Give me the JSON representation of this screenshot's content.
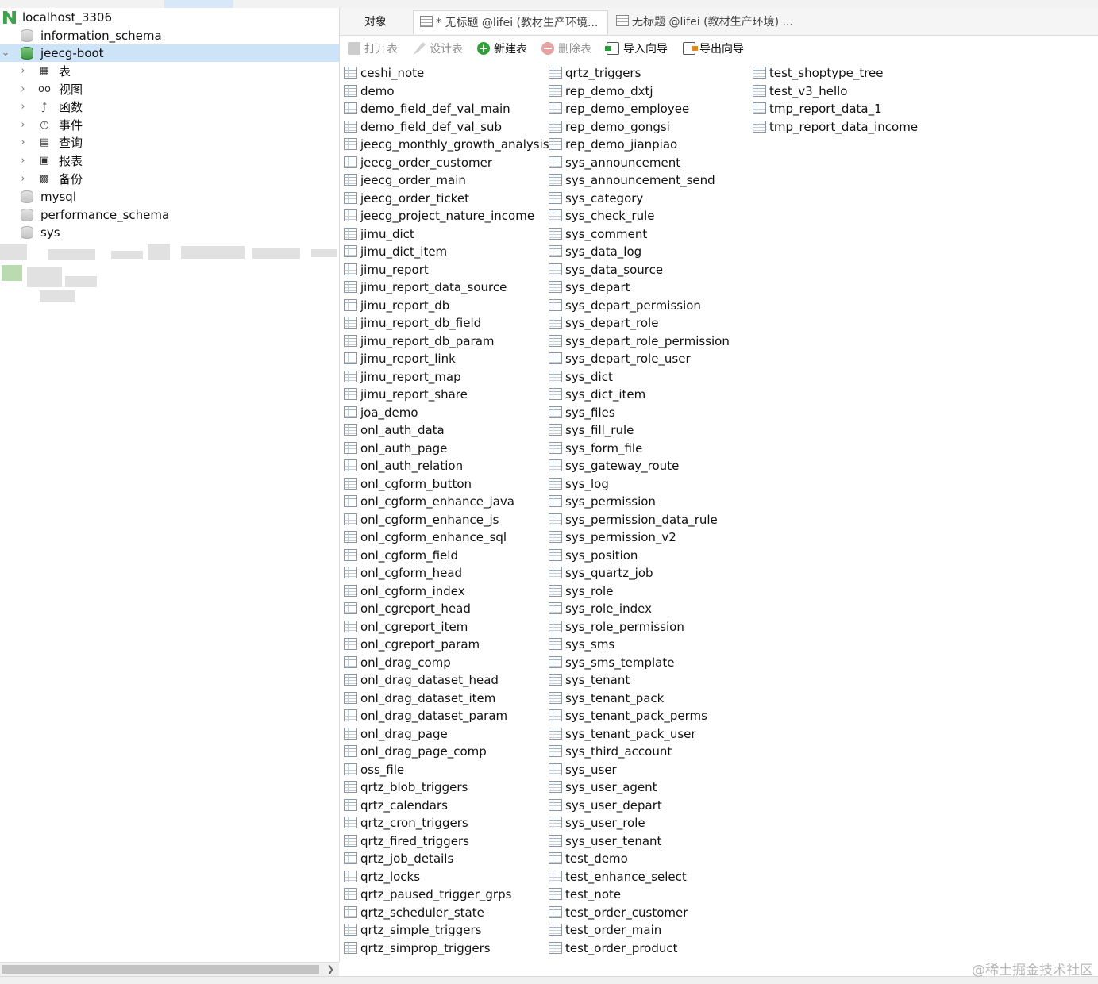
{
  "sidebar": {
    "connection": "localhost_3306",
    "databases": [
      "information_schema",
      "jeecg-boot"
    ],
    "categories": [
      {
        "label": "表",
        "icon": "table-icon"
      },
      {
        "label": "视图",
        "icon": "view-icon"
      },
      {
        "label": "函数",
        "icon": "function-icon"
      },
      {
        "label": "事件",
        "icon": "event-icon"
      },
      {
        "label": "查询",
        "icon": "query-icon"
      },
      {
        "label": "报表",
        "icon": "report-icon"
      },
      {
        "label": "备份",
        "icon": "backup-icon"
      }
    ],
    "other_databases": [
      "mysql",
      "performance_schema",
      "sys"
    ]
  },
  "tabs": {
    "objects": "对象",
    "tab1": "* 无标题 @lifei (教材生产环境...",
    "tab2": "无标题 @lifei (教材生产环境) ..."
  },
  "toolbar": {
    "open": "打开表",
    "design": "设计表",
    "new": "新建表",
    "delete": "删除表",
    "import": "导入向导",
    "export": "导出向导"
  },
  "tables": {
    "col1": [
      "ceshi_note",
      "demo",
      "demo_field_def_val_main",
      "demo_field_def_val_sub",
      "jeecg_monthly_growth_analysis",
      "jeecg_order_customer",
      "jeecg_order_main",
      "jeecg_order_ticket",
      "jeecg_project_nature_income",
      "jimu_dict",
      "jimu_dict_item",
      "jimu_report",
      "jimu_report_data_source",
      "jimu_report_db",
      "jimu_report_db_field",
      "jimu_report_db_param",
      "jimu_report_link",
      "jimu_report_map",
      "jimu_report_share",
      "joa_demo",
      "onl_auth_data",
      "onl_auth_page",
      "onl_auth_relation",
      "onl_cgform_button",
      "onl_cgform_enhance_java",
      "onl_cgform_enhance_js",
      "onl_cgform_enhance_sql",
      "onl_cgform_field",
      "onl_cgform_head",
      "onl_cgform_index",
      "onl_cgreport_head",
      "onl_cgreport_item",
      "onl_cgreport_param",
      "onl_drag_comp",
      "onl_drag_dataset_head",
      "onl_drag_dataset_item",
      "onl_drag_dataset_param",
      "onl_drag_page",
      "onl_drag_page_comp",
      "oss_file",
      "qrtz_blob_triggers",
      "qrtz_calendars",
      "qrtz_cron_triggers",
      "qrtz_fired_triggers",
      "qrtz_job_details",
      "qrtz_locks",
      "qrtz_paused_trigger_grps",
      "qrtz_scheduler_state",
      "qrtz_simple_triggers",
      "qrtz_simprop_triggers"
    ],
    "col2": [
      "qrtz_triggers",
      "rep_demo_dxtj",
      "rep_demo_employee",
      "rep_demo_gongsi",
      "rep_demo_jianpiao",
      "sys_announcement",
      "sys_announcement_send",
      "sys_category",
      "sys_check_rule",
      "sys_comment",
      "sys_data_log",
      "sys_data_source",
      "sys_depart",
      "sys_depart_permission",
      "sys_depart_role",
      "sys_depart_role_permission",
      "sys_depart_role_user",
      "sys_dict",
      "sys_dict_item",
      "sys_files",
      "sys_fill_rule",
      "sys_form_file",
      "sys_gateway_route",
      "sys_log",
      "sys_permission",
      "sys_permission_data_rule",
      "sys_permission_v2",
      "sys_position",
      "sys_quartz_job",
      "sys_role",
      "sys_role_index",
      "sys_role_permission",
      "sys_sms",
      "sys_sms_template",
      "sys_tenant",
      "sys_tenant_pack",
      "sys_tenant_pack_perms",
      "sys_tenant_pack_user",
      "sys_third_account",
      "sys_user",
      "sys_user_agent",
      "sys_user_depart",
      "sys_user_role",
      "sys_user_tenant",
      "test_demo",
      "test_enhance_select",
      "test_note",
      "test_order_customer",
      "test_order_main",
      "test_order_product"
    ],
    "col3": [
      "test_shoptype_tree",
      "test_v3_hello",
      "tmp_report_data_1",
      "tmp_report_data_income"
    ]
  },
  "watermark": "@稀土掘金技术社区"
}
